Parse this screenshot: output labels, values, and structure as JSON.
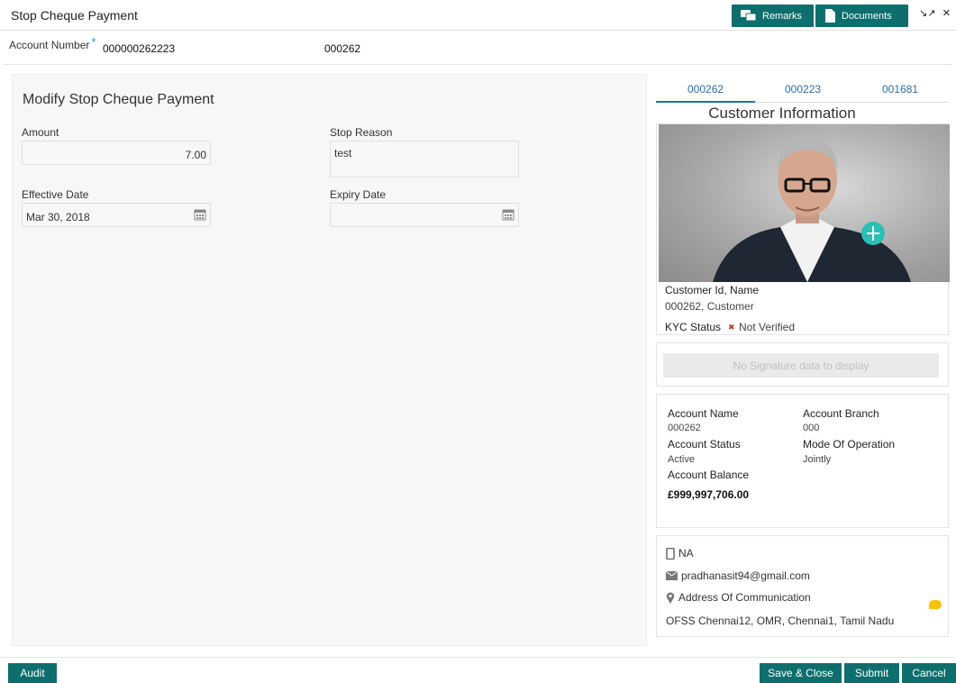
{
  "header": {
    "title": "Stop Cheque Payment",
    "remarks_label": "Remarks",
    "documents_label": "Documents",
    "minimize_glyph": "↘↗",
    "close_glyph": "×"
  },
  "account_bar": {
    "label": "Account Number",
    "required_marker": "*",
    "account_number": "000000262223",
    "branch": "000262"
  },
  "form": {
    "section_title": "Modify Stop Cheque Payment",
    "amount_label": "Amount",
    "amount_value": "7.00",
    "stop_reason_label": "Stop Reason",
    "stop_reason_value": "test",
    "effective_date_label": "Effective Date",
    "effective_date_value": "Mar 30, 2018",
    "expiry_date_label": "Expiry Date",
    "expiry_date_value": ""
  },
  "customer_panel": {
    "tabs": [
      "000262",
      "000223",
      "001681"
    ],
    "title": "Customer Information",
    "id_name_label": "Customer Id, Name",
    "id_name_value": "000262, Customer",
    "kyc_label": "KYC Status",
    "kyc_icon": "✖",
    "kyc_value": "Not Verified",
    "signature_empty": "No Signature data to display"
  },
  "account_info": {
    "account_name_label": "Account Name",
    "account_name_value": "000262",
    "account_branch_label": "Account Branch",
    "account_branch_value": "000",
    "account_status_label": "Account Status",
    "account_status_value": "Active",
    "mode_label": "Mode Of Operation",
    "mode_value": "Jointly",
    "balance_label": "Account Balance",
    "balance_value": "£999,997,706.00"
  },
  "contact": {
    "phone": "NA",
    "email": "pradhanasit94@gmail.com",
    "address_label": "Address Of Communication",
    "address": "OFSS Chennai12, OMR, Chennai1, Tamil Nadu"
  },
  "footer": {
    "audit_label": "Audit",
    "save_close_label": "Save & Close",
    "submit_label": "Submit",
    "cancel_label": "Cancel"
  },
  "colors": {
    "primary_button": "#0e6e6d",
    "tab_active": "#2c6ea5",
    "kyc_cross": "#c0392b",
    "accent_yellow": "#f4c20d"
  }
}
